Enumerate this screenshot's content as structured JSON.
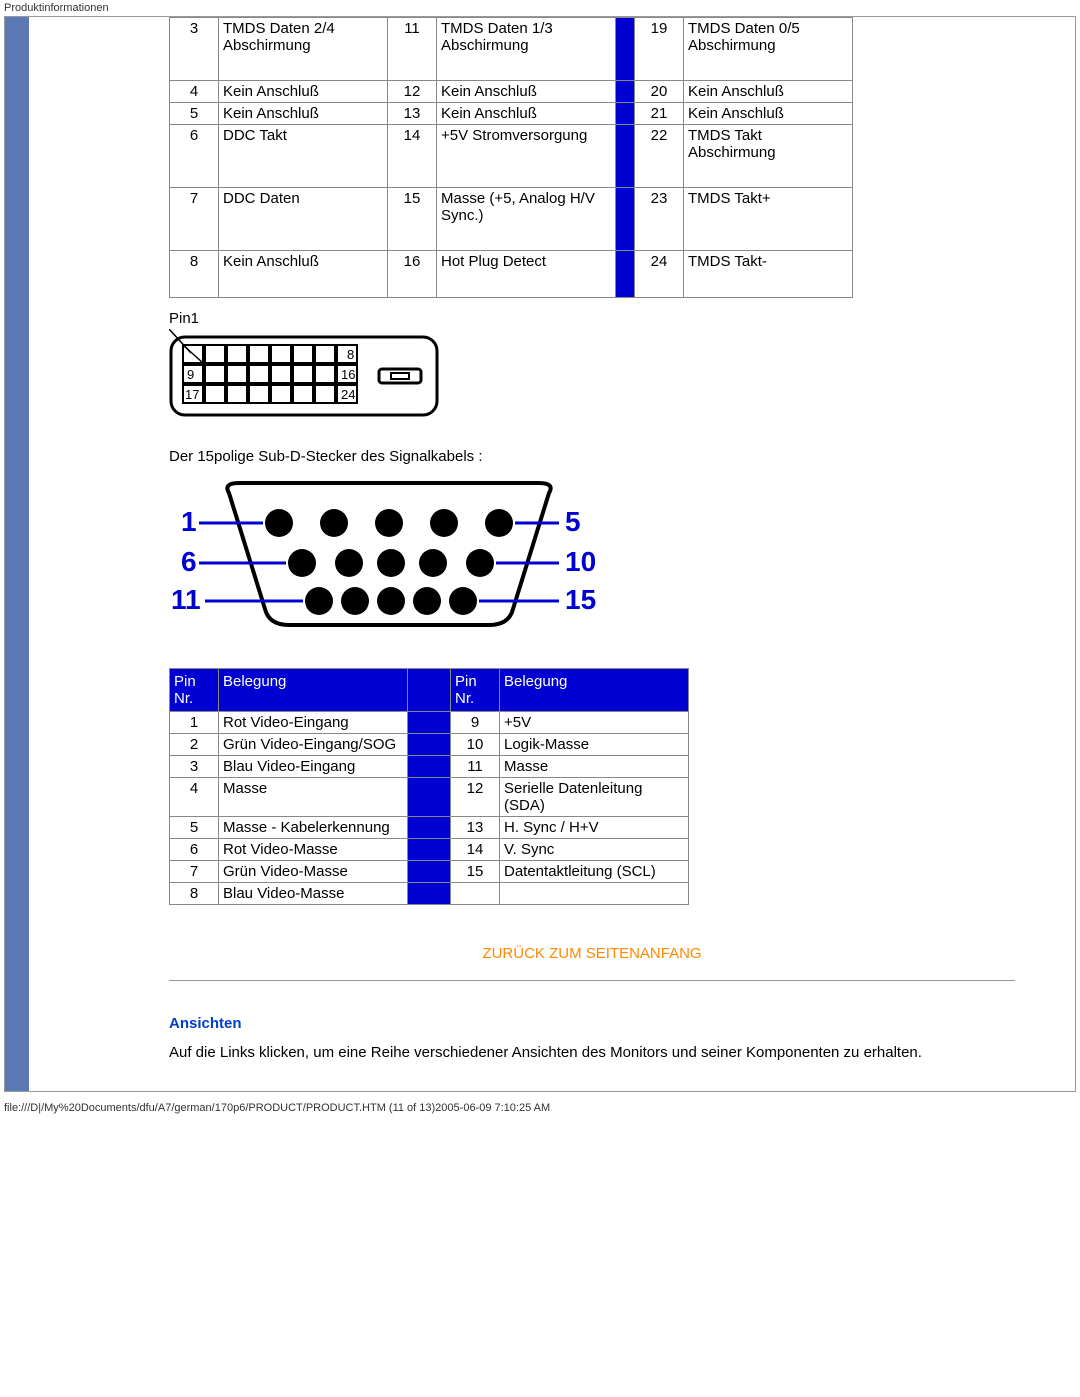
{
  "header": "Produktinformationen",
  "dvi_table": {
    "rows": [
      {
        "p1": "3",
        "d1": "TMDS Daten 2/4 Abschirmung",
        "p2": "11",
        "d2": "TMDS Daten 1/3 Abschirmung",
        "p3": "19",
        "d3": "TMDS Daten 0/5 Abschirmung",
        "tall": true
      },
      {
        "p1": "4",
        "d1": "Kein Anschluß",
        "p2": "12",
        "d2": "Kein Anschluß",
        "p3": "20",
        "d3": "Kein Anschluß"
      },
      {
        "p1": "5",
        "d1": "Kein Anschluß",
        "p2": "13",
        "d2": "Kein Anschluß",
        "p3": "21",
        "d3": "Kein Anschluß"
      },
      {
        "p1": "6",
        "d1": "DDC Takt",
        "p2": "14",
        "d2": "+5V Stromversorgung",
        "p3": "22",
        "d3": "TMDS Takt Abschirmung",
        "tall": true
      },
      {
        "p1": "7",
        "d1": "DDC Daten",
        "p2": "15",
        "d2": "Masse (+5, Analog H/V Sync.)",
        "p3": "23",
        "d3": "TMDS Takt+",
        "tall": true
      },
      {
        "p1": "8",
        "d1": "Kein Anschluß",
        "p2": "16",
        "d2": "Hot Plug Detect",
        "p3": "24",
        "d3": "TMDS Takt-",
        "med": true
      }
    ]
  },
  "pin1_label": "Pin1",
  "dvi_diagram": {
    "pins": [
      "8",
      "9",
      "16",
      "17",
      "24"
    ]
  },
  "vga_caption": "Der 15polige Sub-D-Stecker des Signalkabels :",
  "vga_diagram": {
    "left": [
      "1",
      "6",
      "11"
    ],
    "right": [
      "5",
      "10",
      "15"
    ]
  },
  "vga_table": {
    "headers": {
      "pin": "Pin Nr.",
      "assign": "Belegung"
    },
    "left": [
      {
        "n": "1",
        "d": "Rot Video-Eingang"
      },
      {
        "n": "2",
        "d": "Grün Video-Eingang/SOG"
      },
      {
        "n": "3",
        "d": "Blau Video-Eingang"
      },
      {
        "n": "4",
        "d": "Masse"
      },
      {
        "n": "5",
        "d": "Masse - Kabelerkennung"
      },
      {
        "n": "6",
        "d": "Rot Video-Masse"
      },
      {
        "n": "7",
        "d": "Grün Video-Masse"
      },
      {
        "n": "8",
        "d": "Blau Video-Masse"
      }
    ],
    "right": [
      {
        "n": "9",
        "d": "+5V"
      },
      {
        "n": "10",
        "d": "Logik-Masse"
      },
      {
        "n": "11",
        "d": "Masse"
      },
      {
        "n": "12",
        "d": "Serielle Datenleitung (SDA)"
      },
      {
        "n": "13",
        "d": "H. Sync / H+V"
      },
      {
        "n": "14",
        "d": "V. Sync"
      },
      {
        "n": "15",
        "d": "Datentaktleitung (SCL)"
      },
      {
        "n": "",
        "d": ""
      }
    ]
  },
  "back_to_top": "ZURÜCK ZUM SEITENANFANG",
  "views": {
    "title": "Ansichten",
    "text": "Auf die Links klicken, um eine Reihe verschiedener Ansichten des Monitors und seiner Komponenten zu erhalten."
  },
  "footer": "file:///D|/My%20Documents/dfu/A7/german/170p6/PRODUCT/PRODUCT.HTM (11 of 13)2005-06-09 7:10:25 AM"
}
